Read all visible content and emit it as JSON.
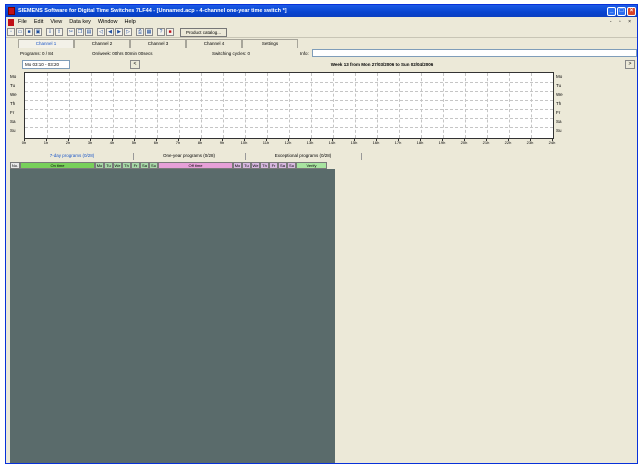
{
  "window": {
    "title": "SIEMENS Software for Digital Time Switches 7LF44 - [Unnamed.acp - 4-channel one-year time switch *]"
  },
  "menu": [
    "File",
    "Edit",
    "View",
    "Data key",
    "Window",
    "Help"
  ],
  "toolbar": {
    "product_catalog": "Product catalog..."
  },
  "tabs": [
    "Channel 1",
    "Channel 2",
    "Channel 3",
    "Channel 4",
    "Settings"
  ],
  "info": {
    "programs": "Programs: 0 / 84",
    "on_week": "On/week: 00hrs 00min 00secs",
    "switching_cycles": "Switching cycles: 0",
    "info_label": "Info:",
    "info_value": ""
  },
  "week": {
    "range": "Mo 03:10 - 03:20",
    "title": "Week 13  from  Mon 27/03/2006  to  Sun 02/04/2006",
    "prev": "<",
    "next": ">"
  },
  "days": [
    "Mo",
    "Tu",
    "We",
    "Th",
    "Fr",
    "Sa",
    "Su"
  ],
  "hours": [
    "0h",
    "1h",
    "2h",
    "3h",
    "4h",
    "5h",
    "6h",
    "7h",
    "8h",
    "9h",
    "10h",
    "11h",
    "12h",
    "13h",
    "14h",
    "15h",
    "16h",
    "17h",
    "18h",
    "19h",
    "20h",
    "21h",
    "22h",
    "23h",
    "24h"
  ],
  "subtabs": [
    "7-day programs (0/28)",
    "One-year programs (0/28)",
    "Exceptional programs (0/28)"
  ],
  "grid_columns": {
    "no": "No.",
    "on_time": "On time",
    "on_days": [
      "Mo",
      "Tu",
      "We",
      "Th",
      "Fr",
      "Sa",
      "Su"
    ],
    "off_time": "Off time",
    "off_days": [
      "Mo",
      "Tu",
      "We",
      "Th",
      "Fr",
      "Sa",
      "Su"
    ],
    "verify": "Verify"
  }
}
